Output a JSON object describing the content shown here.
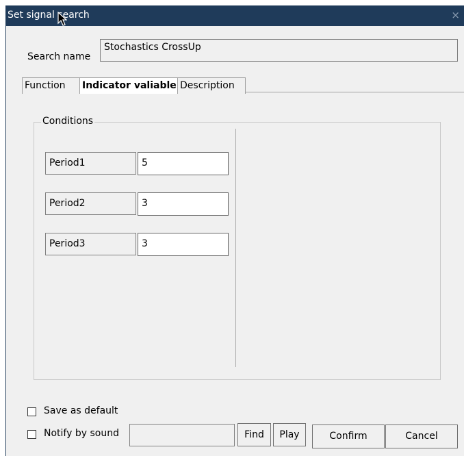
{
  "window": {
    "title": "Set signal search",
    "close_glyph": "×"
  },
  "search": {
    "label": "Search name",
    "value": "Stochastics CrossUp"
  },
  "tabs": [
    {
      "label": "Function",
      "active": false
    },
    {
      "label": "Indicator valiable",
      "active": true
    },
    {
      "label": "Description",
      "active": false
    }
  ],
  "conditions": {
    "legend": "Conditions",
    "rows": [
      {
        "label": "Period1",
        "value": "5"
      },
      {
        "label": "Period2",
        "value": "3"
      },
      {
        "label": "Period3",
        "value": "3"
      }
    ]
  },
  "options": {
    "save_default_label": "Save as default",
    "notify_sound_label": "Notify by sound",
    "sound_file_value": ""
  },
  "buttons": {
    "find": "Find",
    "play": "Play",
    "confirm": "Confirm",
    "cancel": "Cancel"
  },
  "colors": {
    "titlebar": "#1f3b5a",
    "dialog_bg": "#f0f0f0"
  }
}
